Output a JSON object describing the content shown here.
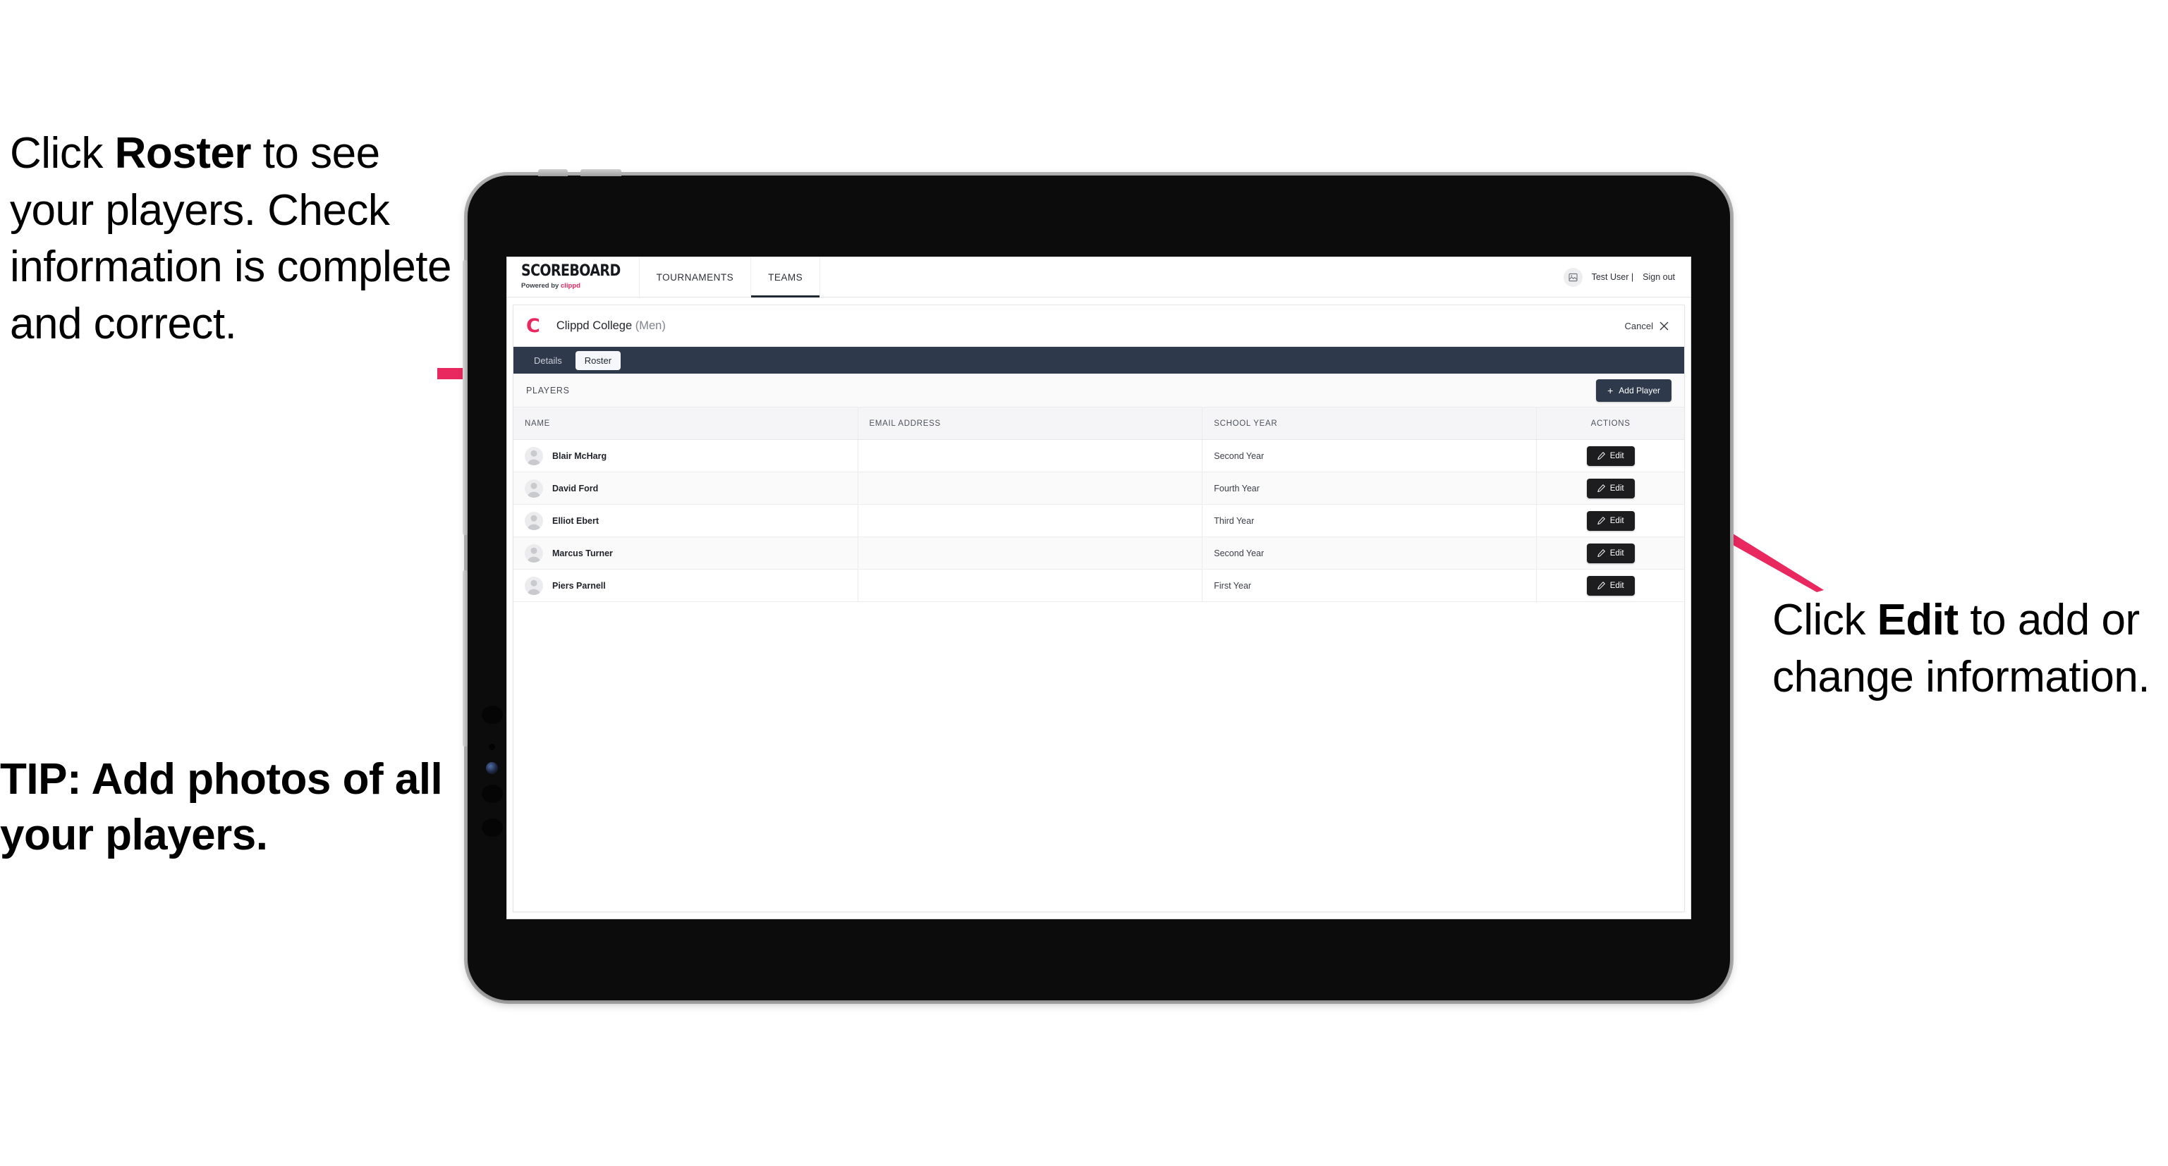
{
  "annotations": {
    "left": {
      "lead": "Click ",
      "bold": "Roster",
      "rest": " to see your players. Check information is complete and correct."
    },
    "tip": "TIP: Add photos of all your players.",
    "right": {
      "lead": "Click ",
      "bold": "Edit",
      "rest": " to add or change information."
    },
    "arrow_color": "#e8285f"
  },
  "app": {
    "brand": {
      "title": "SCOREBOARD",
      "powered_by": "Powered by ",
      "powered_brand": "clippd"
    },
    "nav_tabs": [
      {
        "label": "TOURNAMENTS",
        "active": false
      },
      {
        "label": "TEAMS",
        "active": true
      }
    ],
    "user": {
      "name": "Test User |",
      "sign_out": "Sign out",
      "avatar_icon": "broken-image-icon"
    },
    "page_header": {
      "logo_letter": "C",
      "team_name": "Clippd College",
      "team_gender": "(Men)",
      "cancel_label": "Cancel",
      "close_icon": "close-x-icon"
    },
    "sub_tabs": [
      {
        "label": "Details",
        "active": false
      },
      {
        "label": "Roster",
        "active": true
      }
    ],
    "players_section": {
      "label": "PLAYERS",
      "add_button": "Add Player",
      "add_icon": "plus-icon"
    },
    "table": {
      "columns": [
        "NAME",
        "EMAIL ADDRESS",
        "SCHOOL YEAR",
        "ACTIONS"
      ],
      "action_label": "Edit",
      "action_icon": "pencil-icon",
      "rows": [
        {
          "name": "Blair McHarg",
          "email": "",
          "school_year": "Second Year"
        },
        {
          "name": "David Ford",
          "email": "",
          "school_year": "Fourth Year"
        },
        {
          "name": "Elliot Ebert",
          "email": "",
          "school_year": "Third Year"
        },
        {
          "name": "Marcus Turner",
          "email": "",
          "school_year": "Second Year"
        },
        {
          "name": "Piers Parnell",
          "email": "",
          "school_year": "First Year"
        }
      ]
    },
    "colors": {
      "accent_pink": "#e8285f",
      "navy": "#2e3a4c",
      "dark_button": "#1d1d1f"
    }
  }
}
